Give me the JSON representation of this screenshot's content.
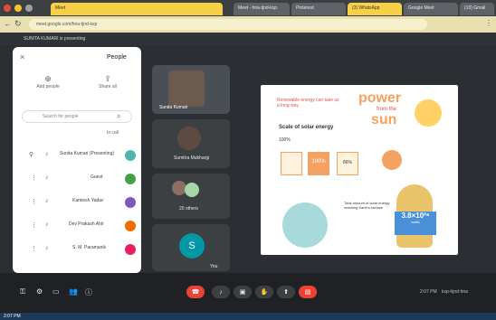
{
  "browser": {
    "tabs": [
      {
        "label": "(10) Gmail"
      },
      {
        "label": "Meet"
      },
      {
        "label": "Meet - hna-tjnd-kxp"
      },
      {
        "label": "Pinterest"
      },
      {
        "label": "(3) WhatsApp"
      },
      {
        "label": "Google Meet"
      }
    ],
    "url": "meet.google.com/hna-tjnd-kxp"
  },
  "meet": {
    "presenting": "SUNITA KUMARI is presenting",
    "meeting_code": "kxp-hjnd-hna",
    "time": "2:07 PM"
  },
  "people": {
    "title": "People",
    "actions": [
      {
        "label": "Share all"
      },
      {
        "label": "Add people"
      }
    ],
    "search_placeholder": "Search for people",
    "section": "In call",
    "participants": [
      {
        "name": "Sunita Kumari (Presenting)",
        "color": "#4db6ac"
      },
      {
        "name": "Guest",
        "color": "#43a047"
      },
      {
        "name": "Kamlesh Yadav",
        "color": "#7e57c2"
      },
      {
        "name": "Dev Prakash Ahir",
        "color": "#ef6c00"
      },
      {
        "name": "S. M. Paramanik",
        "color": "#e91e63"
      }
    ]
  },
  "tiles": [
    {
      "name": "Sunita Kumari"
    },
    {
      "name": "Sumitra Mukhargi"
    },
    {
      "name": "20 others"
    },
    {
      "name": "You"
    }
  ],
  "slide": {
    "title1": "power",
    "title2": "from the",
    "title3": "sun",
    "intro": "Renewable energy can take us a long way",
    "scale": "Scale of solar energy",
    "stat1": "100%",
    "stat2": "3.8x10²⁶",
    "stat3": "86%",
    "big": "3.8×10²⁶",
    "big_unit": "watts",
    "fact": "Total amount of solar energy reaching Earth's surface"
  },
  "taskbar": {
    "clock": "2:07 PM"
  }
}
